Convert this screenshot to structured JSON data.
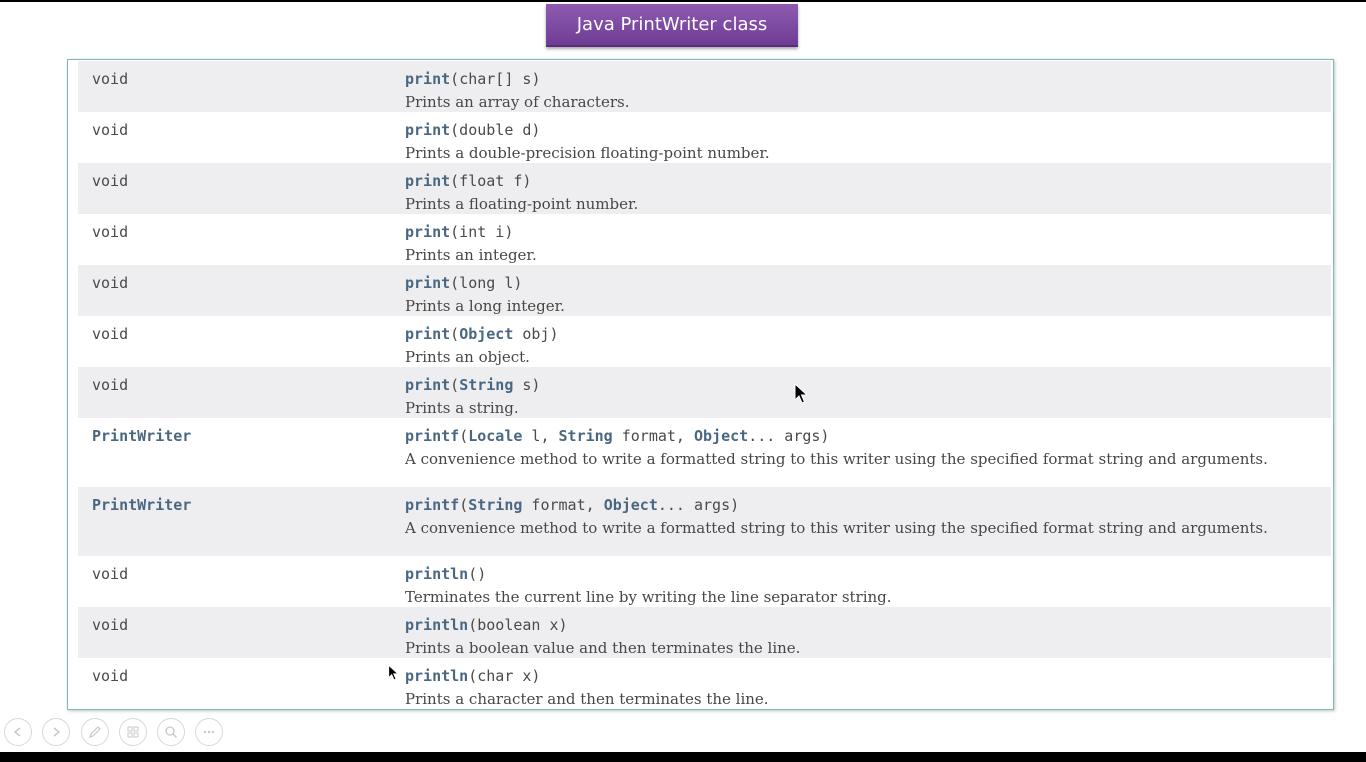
{
  "slide": {
    "title": "Java PrintWriter class"
  },
  "methods": [
    {
      "type": "void",
      "type_is_link": false,
      "name": "print",
      "sig": [
        [
          "(",
          "p"
        ],
        [
          "char[] s",
          "p"
        ],
        [
          ")",
          "p"
        ]
      ],
      "desc": "Prints an array of characters."
    },
    {
      "type": "void",
      "type_is_link": false,
      "name": "print",
      "sig": [
        [
          "(double d)",
          "p"
        ]
      ],
      "desc": "Prints a double-precision floating-point number."
    },
    {
      "type": "void",
      "type_is_link": false,
      "name": "print",
      "sig": [
        [
          "(float f)",
          "p"
        ]
      ],
      "desc": "Prints a floating-point number."
    },
    {
      "type": "void",
      "type_is_link": false,
      "name": "print",
      "sig": [
        [
          "(int i)",
          "p"
        ]
      ],
      "desc": "Prints an integer."
    },
    {
      "type": "void",
      "type_is_link": false,
      "name": "print",
      "sig": [
        [
          "(long l)",
          "p"
        ]
      ],
      "desc": "Prints a long integer."
    },
    {
      "type": "void",
      "type_is_link": false,
      "name": "print",
      "sig": [
        [
          "(",
          "p"
        ],
        [
          "Object",
          "l"
        ],
        [
          " obj)",
          "p"
        ]
      ],
      "desc": "Prints an object."
    },
    {
      "type": "void",
      "type_is_link": false,
      "name": "print",
      "sig": [
        [
          "(",
          "p"
        ],
        [
          "String",
          "l"
        ],
        [
          " s)",
          "p"
        ]
      ],
      "desc": "Prints a string."
    },
    {
      "type": "PrintWriter",
      "type_is_link": true,
      "name": "printf",
      "sig": [
        [
          "(",
          "p"
        ],
        [
          "Locale",
          "l"
        ],
        [
          " l, ",
          "p"
        ],
        [
          "String",
          "l"
        ],
        [
          " format, ",
          "p"
        ],
        [
          "Object",
          "l"
        ],
        [
          "... args)",
          "p"
        ]
      ],
      "desc": "A convenience method to write a formatted string to this writer using the specified format string and arguments."
    },
    {
      "type": "PrintWriter",
      "type_is_link": true,
      "name": "printf",
      "sig": [
        [
          "(",
          "p"
        ],
        [
          "String",
          "l"
        ],
        [
          " format, ",
          "p"
        ],
        [
          "Object",
          "l"
        ],
        [
          "... args)",
          "p"
        ]
      ],
      "desc": "A convenience method to write a formatted string to this writer using the specified format string and arguments."
    },
    {
      "type": "void",
      "type_is_link": false,
      "name": "println",
      "sig": [
        [
          "()",
          "p"
        ]
      ],
      "desc": "Terminates the current line by writing the line separator string."
    },
    {
      "type": "void",
      "type_is_link": false,
      "name": "println",
      "sig": [
        [
          "(boolean x)",
          "p"
        ]
      ],
      "desc": "Prints a boolean value and then terminates the line."
    },
    {
      "type": "void",
      "type_is_link": false,
      "name": "println",
      "sig": [
        [
          "(char x)",
          "p"
        ]
      ],
      "desc": "Prints a character and then terminates the line."
    }
  ],
  "nav_icons": [
    "previous-slide-icon",
    "next-slide-icon",
    "pen-icon",
    "slides-grid-icon",
    "zoom-icon",
    "more-options-icon"
  ],
  "colors": {
    "title_bg": "#7b4aa0",
    "frame_border": "#7fb7bd",
    "link_text": "#4a6782",
    "row_alt_bg": "#eeeef0"
  }
}
